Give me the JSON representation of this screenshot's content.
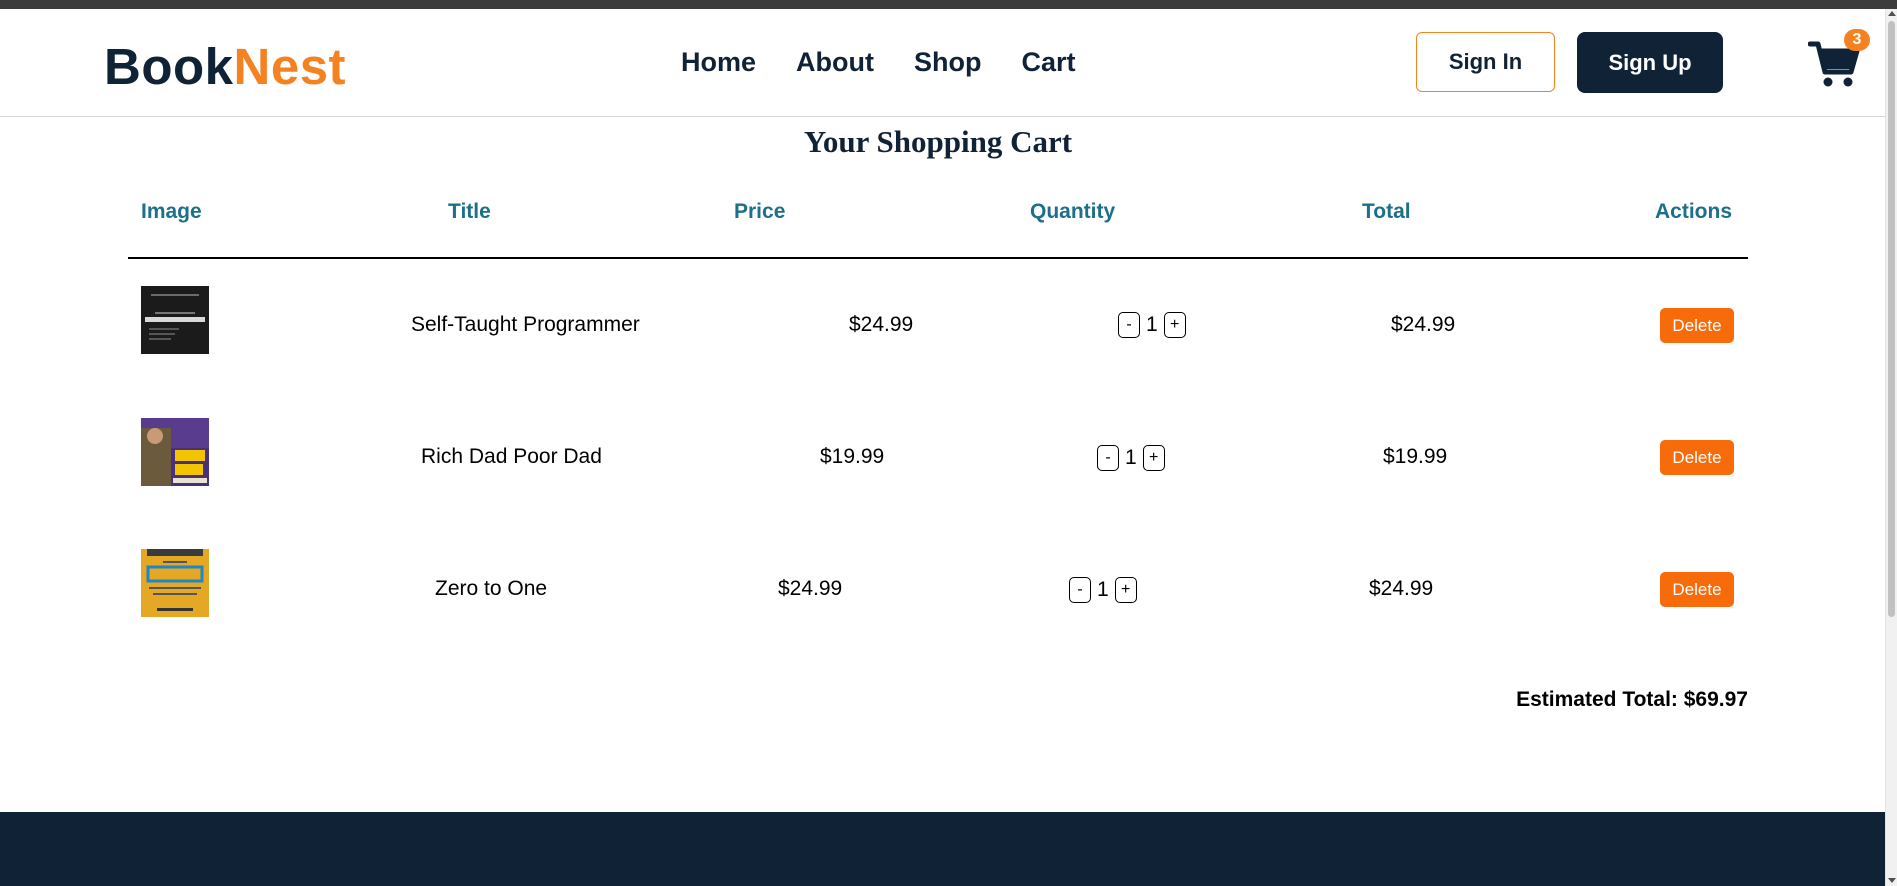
{
  "brand": {
    "part1": "Book",
    "part2": "Nest"
  },
  "nav": {
    "items": [
      "Home",
      "About",
      "Shop",
      "Cart"
    ]
  },
  "auth": {
    "sign_in": "Sign In",
    "sign_up": "Sign Up"
  },
  "cart": {
    "badge": "3",
    "icon": "shopping-cart-icon"
  },
  "page": {
    "title": "Your Shopping Cart"
  },
  "table": {
    "headers": {
      "image": "Image",
      "title": "Title",
      "price": "Price",
      "quantity": "Quantity",
      "total": "Total",
      "actions": "Actions"
    },
    "rows": [
      {
        "title": "Self-Taught Programmer",
        "price": "$24.99",
        "quantity": "1",
        "total": "$24.99",
        "delete": "Delete",
        "minus": "-",
        "plus": "+",
        "cover": "book-cover-self-taught-programmer"
      },
      {
        "title": "Rich Dad Poor Dad",
        "price": "$19.99",
        "quantity": "1",
        "total": "$19.99",
        "delete": "Delete",
        "minus": "-",
        "plus": "+",
        "cover": "book-cover-rich-dad-poor-dad"
      },
      {
        "title": "Zero to One",
        "price": "$24.99",
        "quantity": "1",
        "total": "$24.99",
        "delete": "Delete",
        "minus": "-",
        "plus": "+",
        "cover": "book-cover-zero-to-one"
      }
    ]
  },
  "summary": {
    "estimated_total": "Estimated Total: $69.97"
  },
  "colors": {
    "navy": "#0f2236",
    "orange": "#f58220",
    "header_teal": "#1d6f8a",
    "delete_orange": "#f76b0a"
  }
}
